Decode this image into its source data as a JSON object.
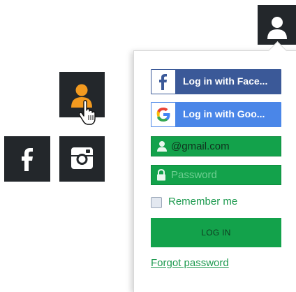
{
  "icons": {
    "account_toggle": "user-icon",
    "account_button": "user-icon",
    "cursor": "hand-pointer-icon",
    "facebook_square": "facebook-icon",
    "instagram_square": "instagram-icon"
  },
  "colors": {
    "dark_square": "#23272b",
    "user_icon_active": "#f39a1f",
    "facebook_blue": "#3b5998",
    "google_blue": "#4a86e8",
    "form_green": "#13a24b",
    "link_green": "#1d9a4f"
  },
  "login_panel": {
    "facebook_button": {
      "label": "Log in with Face...",
      "icon": "facebook-f-icon"
    },
    "google_button": {
      "label": "Log in with Goo...",
      "icon": "google-g-icon"
    },
    "email_field": {
      "value": "@gmail.com",
      "icon": "user-icon"
    },
    "password_field": {
      "placeholder": "Password",
      "icon": "lock-icon"
    },
    "remember_me": {
      "label": "Remember me",
      "checked": false
    },
    "login_button": {
      "label": "LOG IN"
    },
    "forgot_link": {
      "label": "Forgot password"
    }
  }
}
